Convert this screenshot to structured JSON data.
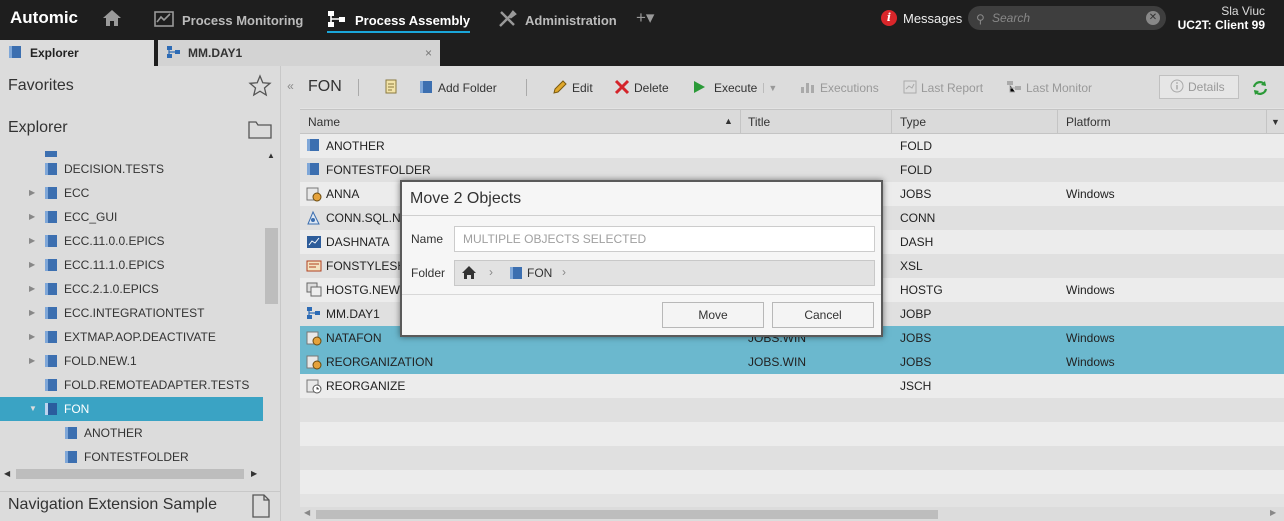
{
  "topbar": {
    "logo": "Automic",
    "nav": [
      {
        "label": "Process Monitoring"
      },
      {
        "label": "Process Assembly"
      },
      {
        "label": "Administration"
      }
    ],
    "plus": "+▾",
    "messages": "Messages",
    "search_placeholder": "Search",
    "user_name": "Sla Viuc",
    "client": "UC2T: Client 99"
  },
  "tabs": [
    {
      "label": "Explorer"
    },
    {
      "label": "MM.DAY1",
      "close": "×"
    }
  ],
  "left": {
    "favorites": "Favorites",
    "explorer": "Explorer",
    "tree": [
      {
        "label": "DECISION.TESTS"
      },
      {
        "label": "ECC"
      },
      {
        "label": "ECC_GUI"
      },
      {
        "label": "ECC.11.0.0.EPICS"
      },
      {
        "label": "ECC.11.1.0.EPICS"
      },
      {
        "label": "ECC.2.1.0.EPICS"
      },
      {
        "label": "ECC.INTEGRATIONTEST"
      },
      {
        "label": "EXTMAP.AOP.DEACTIVATE"
      },
      {
        "label": "FOLD.NEW.1"
      },
      {
        "label": "FOLD.REMOTEADAPTER.TESTS"
      },
      {
        "label": "FON"
      },
      {
        "label": "ANOTHER"
      },
      {
        "label": "FONTESTFOLDER"
      }
    ],
    "nav_extension": "Navigation Extension Sample"
  },
  "toolbar": {
    "crumb": "FON",
    "add_folder": "Add Folder",
    "edit": "Edit",
    "delete": "Delete",
    "execute": "Execute",
    "executions": "Executions",
    "last_report": "Last Report",
    "last_monitor": "Last Monitor",
    "details": "Details"
  },
  "grid": {
    "columns": [
      "Name",
      "Title",
      "Type",
      "Platform"
    ],
    "rows": [
      {
        "name": "ANOTHER",
        "title": "",
        "type": "FOLD",
        "platform": ""
      },
      {
        "name": "FONTESTFOLDER",
        "title": "",
        "type": "FOLD",
        "platform": ""
      },
      {
        "name": "ANNA",
        "title": "",
        "type": "JOBS",
        "platform": "Windows"
      },
      {
        "name": "CONN.SQL.N",
        "title": "",
        "type": "CONN",
        "platform": ""
      },
      {
        "name": "DASHNATA",
        "title": "",
        "type": "DASH",
        "platform": ""
      },
      {
        "name": "FONSTYLESH",
        "title": "",
        "type": "XSL",
        "platform": ""
      },
      {
        "name": "HOSTG.NEW.",
        "title": "",
        "type": "HOSTG",
        "platform": "Windows"
      },
      {
        "name": "MM.DAY1",
        "title": "",
        "type": "JOBP",
        "platform": ""
      },
      {
        "name": "NATAFON",
        "title": "JOBS.WIN",
        "type": "JOBS",
        "platform": "Windows"
      },
      {
        "name": "REORGANIZATION",
        "title": "JOBS.WIN",
        "type": "JOBS",
        "platform": "Windows"
      },
      {
        "name": "REORGANIZE",
        "title": "",
        "type": "JSCH",
        "platform": ""
      }
    ]
  },
  "dialog": {
    "title": "Move 2 Objects",
    "name_label": "Name",
    "name_placeholder": "MULTIPLE OBJECTS SELECTED",
    "folder_label": "Folder",
    "folder_path": "FON",
    "move": "Move",
    "cancel": "Cancel"
  }
}
